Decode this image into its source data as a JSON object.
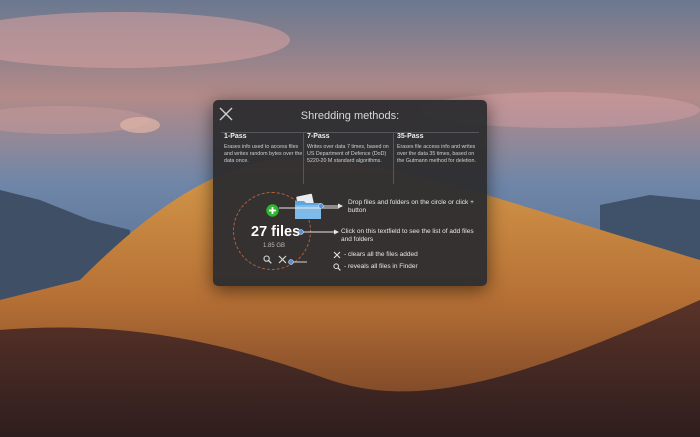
{
  "panel": {
    "title": "Shredding methods:",
    "close_icon": "close-icon"
  },
  "methods": [
    {
      "name": "1-Pass",
      "description": "Erases info used to access files and writes random bytes over the data once."
    },
    {
      "name": "7-Pass",
      "description": "Writes over data 7 times, based on US Department of Defence (DoD) 5220-20 M standard algorithms."
    },
    {
      "name": "35-Pass",
      "description": "Erases file access info and writes over the data 35 times, based on the Gutmann method for deletion."
    }
  ],
  "drop_zone": {
    "count_label": "27 files",
    "size_label": "1.85 GB",
    "add_icon": "plus-circle-icon",
    "reveal_icon": "magnifier-icon",
    "clear_icon": "close-icon"
  },
  "hints": {
    "drop": "Drop files and folders on the circle or click + button",
    "textfield": "Click on this textfield to see the list of add files and folders",
    "clear": "- clears all the files added",
    "reveal": "- reveals all files in Finder"
  },
  "colors": {
    "accent_add": "#2fb52f",
    "circle_border": "#b3613f",
    "panel_bg": "#2e2e30"
  }
}
